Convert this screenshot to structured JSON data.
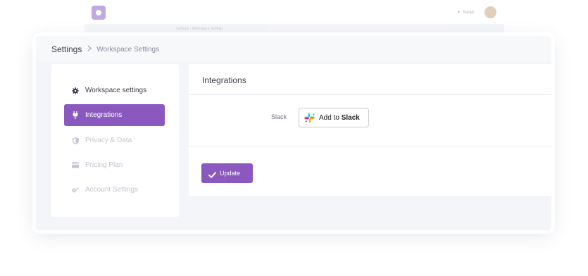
{
  "background": {
    "user_name": "Sarah",
    "breadcrumb_root": "Settings",
    "breadcrumb_current": "Workspace Settings"
  },
  "breadcrumb": {
    "root": "Settings",
    "separator": ">",
    "current": "Workspace Settings"
  },
  "sidebar": {
    "items": [
      {
        "label": "Workspace settings",
        "icon": "gear-icon",
        "state": "normal"
      },
      {
        "label": "Integrations",
        "icon": "plug-icon",
        "state": "active"
      },
      {
        "label": "Privacy & Data",
        "icon": "shield-icon",
        "state": "muted"
      },
      {
        "label": "Pricing Plan",
        "icon": "credit-card-icon",
        "state": "muted"
      },
      {
        "label": "Account Settings",
        "icon": "gears-icon",
        "state": "muted"
      }
    ]
  },
  "panel": {
    "title": "Integrations",
    "slack_label": "Slack",
    "slack_button_prefix": "Add to",
    "slack_button_brand": "Slack",
    "update_label": "Update"
  },
  "colors": {
    "accent": "#8a58bf",
    "page_bg": "#f4f5f8"
  }
}
